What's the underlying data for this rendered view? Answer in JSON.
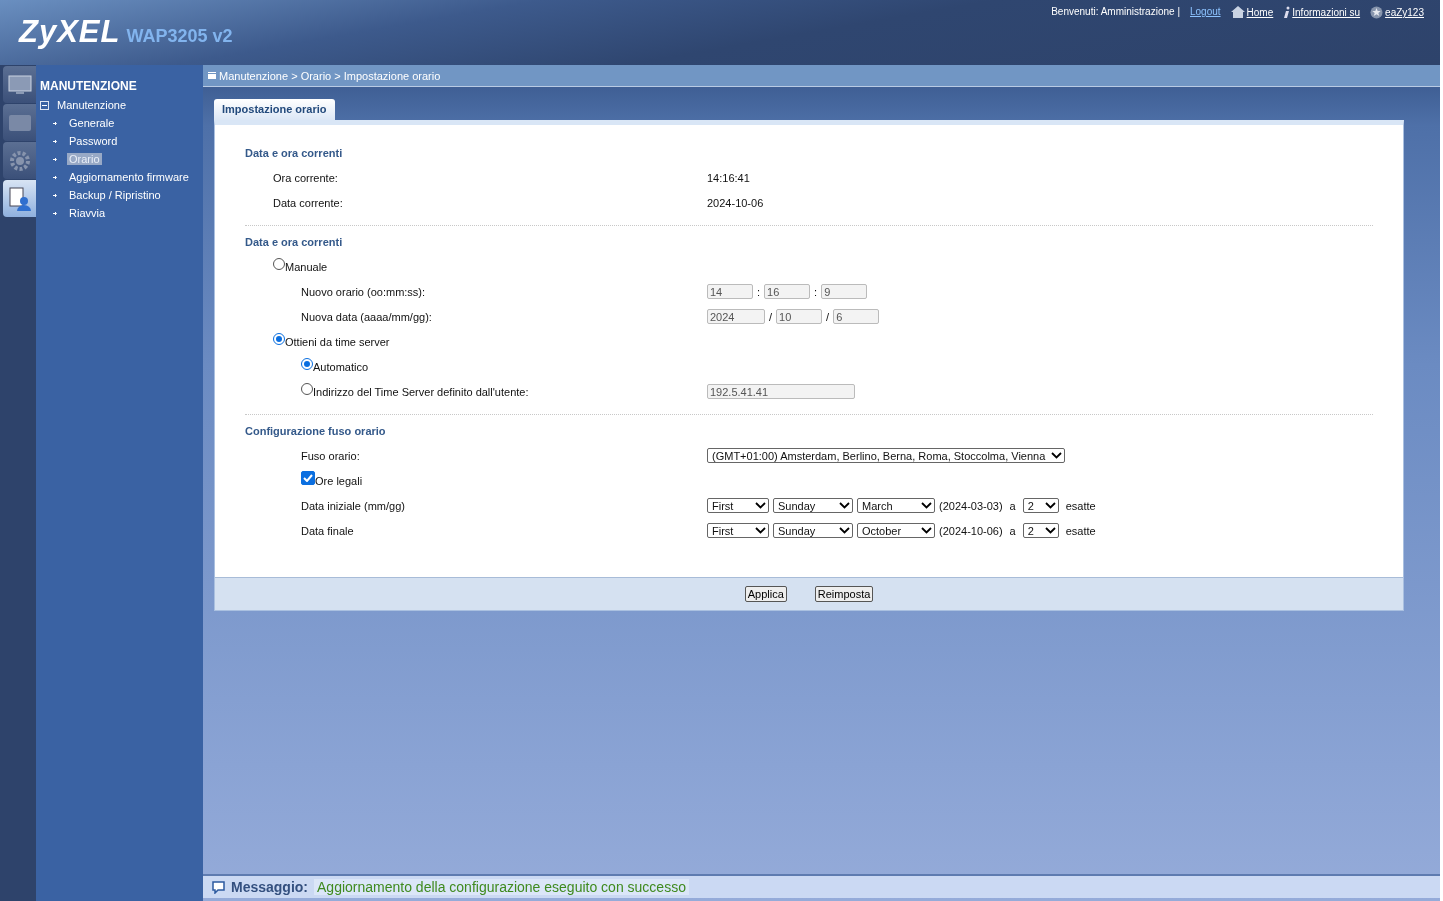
{
  "header": {
    "brand": "ZyXEL",
    "model": "WAP3205 v2",
    "welcome": "Benvenuti: Amministrazione",
    "separator": "|",
    "links": [
      {
        "kind": "logout",
        "label": "Logout"
      },
      {
        "kind": "home",
        "label": "Home"
      },
      {
        "kind": "info",
        "label": "Informazioni su"
      },
      {
        "kind": "easy",
        "label": "eaZy123"
      }
    ]
  },
  "side_tabs": [
    {
      "kind": "monitor",
      "selected": false
    },
    {
      "kind": "screen",
      "selected": false
    },
    {
      "kind": "gear",
      "selected": false
    },
    {
      "kind": "maintenance",
      "selected": true
    }
  ],
  "sidebar": {
    "title": "MANUTENZIONE",
    "group": {
      "label": "Manutenzione",
      "expanded": true,
      "children": [
        {
          "label": "Generale",
          "selected": false
        },
        {
          "label": "Password",
          "selected": false
        },
        {
          "label": "Orario",
          "selected": true
        },
        {
          "label": "Aggiornamento firmware",
          "selected": false
        },
        {
          "label": "Backup / Ripristino",
          "selected": false
        },
        {
          "label": "Riavvia",
          "selected": false
        }
      ]
    }
  },
  "breadcrumb": "Manutenzione > Orario > Impostazione orario",
  "tabs": [
    {
      "label": "Impostazione orario",
      "selected": true
    }
  ],
  "sections": [
    {
      "title": "Data e ora correnti",
      "rows": [
        {
          "kind": "info",
          "label": "Ora corrente:",
          "value": "14:16:41"
        },
        {
          "kind": "info",
          "label": "Data corrente:",
          "value": "2024-10-06"
        }
      ]
    },
    {
      "title": "Data e ora correnti",
      "rows": [
        {
          "kind": "radio",
          "label": "Manuale",
          "selected": false,
          "children": [
            {
              "kind": "fields",
              "label": "Nuovo orario (oo:mm:ss):",
              "disabled": true,
              "fields": [
                {
                  "value": "14"
                },
                {
                  "separator": ":",
                  "value": "16"
                },
                {
                  "separator": ":",
                  "value": "9"
                }
              ]
            },
            {
              "kind": "fields",
              "label": "Nuova data (aaaa/mm/gg):",
              "disabled": true,
              "fields": [
                {
                  "value": "2024"
                },
                {
                  "separator": "/",
                  "value": "10"
                },
                {
                  "separator": "/",
                  "value": "6"
                }
              ]
            }
          ]
        },
        {
          "kind": "radio",
          "label": "Ottieni da time server",
          "selected": true,
          "children": [
            {
              "kind": "radio",
              "label": "Automatico",
              "selected": true
            },
            {
              "kind": "radio",
              "label": "Indirizzo del Time Server definito dall'utente:",
              "selected": false,
              "field": {
                "value": "192.5.41.41",
                "disabled": true
              }
            }
          ]
        }
      ]
    },
    {
      "title": "Configurazione fuso orario",
      "rows": [
        {
          "kind": "radio_group",
          "children": [
            {
              "kind": "select",
              "label": "Fuso orario:",
              "value": "(GMT+01:00) Amsterdam, Berlino, Berna, Roma, Stoccolma, Vienna"
            },
            {
              "kind": "checkbox",
              "label": "Ore legali",
              "checked": true
            },
            {
              "kind": "dst",
              "label": "Data iniziale (mm/gg)",
              "selects": [
                "First",
                "Sunday",
                "March"
              ],
              "date": "(2024-03-03)",
              "at": "a",
              "hour": "2",
              "suffix": "esatte"
            },
            {
              "kind": "dst",
              "label": "Data finale",
              "selects": [
                "First",
                "Sunday",
                "October"
              ],
              "date": "(2024-10-06)",
              "at": "a",
              "hour": "2",
              "suffix": "esatte"
            }
          ]
        }
      ]
    }
  ],
  "buttons": [
    "Applica",
    "Reimposta"
  ],
  "message": {
    "label": "Messaggio:",
    "text": "Aggiornamento della configurazione eseguito con successo"
  }
}
